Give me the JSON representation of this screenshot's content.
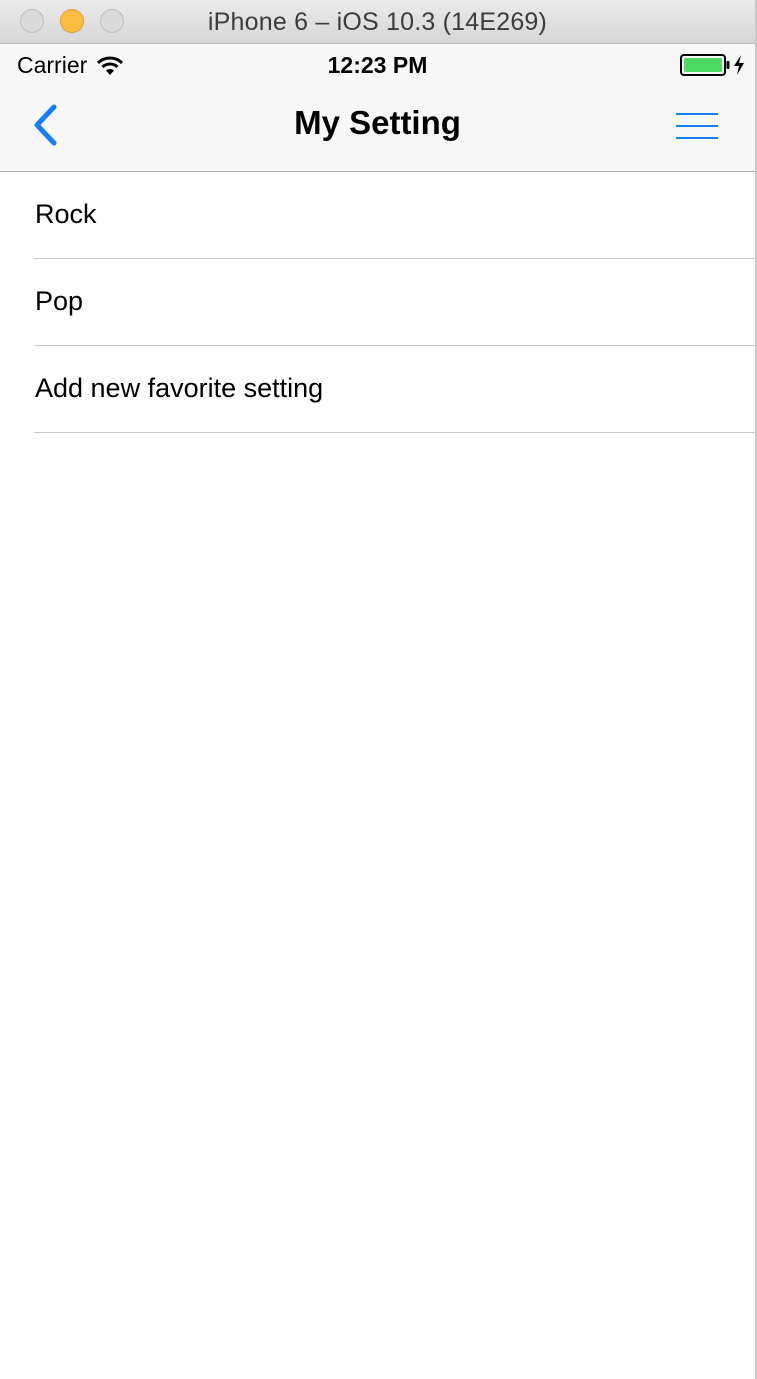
{
  "window": {
    "title": "iPhone 6 – iOS 10.3 (14E269)"
  },
  "status_bar": {
    "carrier": "Carrier",
    "time": "12:23 PM",
    "battery_color": "#4cd964"
  },
  "nav_bar": {
    "title": "My Setting",
    "back_icon": "chevron-left-icon",
    "menu_icon": "hamburger-menu-icon",
    "tint_color": "#157efb"
  },
  "table": {
    "rows": [
      {
        "label": "Rock"
      },
      {
        "label": "Pop"
      },
      {
        "label": "Add new favorite setting"
      }
    ]
  }
}
